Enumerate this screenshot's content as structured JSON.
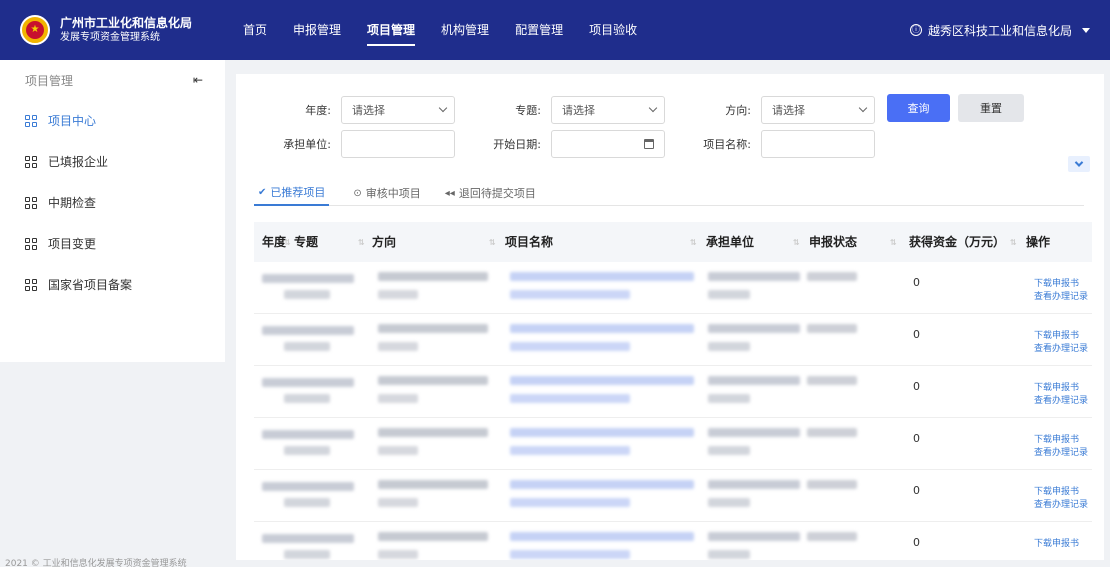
{
  "header": {
    "title": "广州市工业化和信息化局",
    "subtitle": "发展专项资金管理系统",
    "nav": [
      "首页",
      "申报管理",
      "项目管理",
      "机构管理",
      "配置管理",
      "项目验收"
    ],
    "user": "越秀区科技工业和信息化局",
    "colors": {
      "bar": "#1f2d8c",
      "logo": "#f2b400"
    }
  },
  "sidebar": {
    "title": "项目管理",
    "items": [
      "项目中心",
      "已填报企业",
      "中期检查",
      "项目变更",
      "国家省项目备案"
    ]
  },
  "filters": {
    "year_label": "年度:",
    "topic_label": "专题:",
    "direction_label": "方向:",
    "placeholder": "请选择",
    "unit_label": "承担单位:",
    "start_date_label": "开始日期:",
    "project_name_label": "项目名称:",
    "query": "查询",
    "reset": "重置"
  },
  "tabs": [
    "已推荐项目",
    "审核中项目",
    "退回待提交项目"
  ],
  "table": {
    "columns": [
      "年度",
      "专题",
      "方向",
      "项目名称",
      "承担单位",
      "申报状态",
      "获得资金（万元）",
      "操作"
    ],
    "rows": [
      {
        "amount": "0",
        "op1": "下载申报书",
        "op2": "查看办理记录"
      },
      {
        "amount": "0",
        "op1": "下载申报书",
        "op2": "查看办理记录"
      },
      {
        "amount": "0",
        "op1": "下载申报书",
        "op2": "查看办理记录"
      },
      {
        "amount": "0",
        "op1": "下载申报书",
        "op2": "查看办理记录"
      },
      {
        "amount": "0",
        "op1": "下载申报书",
        "op2": "查看办理记录"
      },
      {
        "amount": "0",
        "op1": "下载申报书",
        "op2": ""
      }
    ]
  },
  "footer": "2021 © 工业和信息化发展专项资金管理系统"
}
